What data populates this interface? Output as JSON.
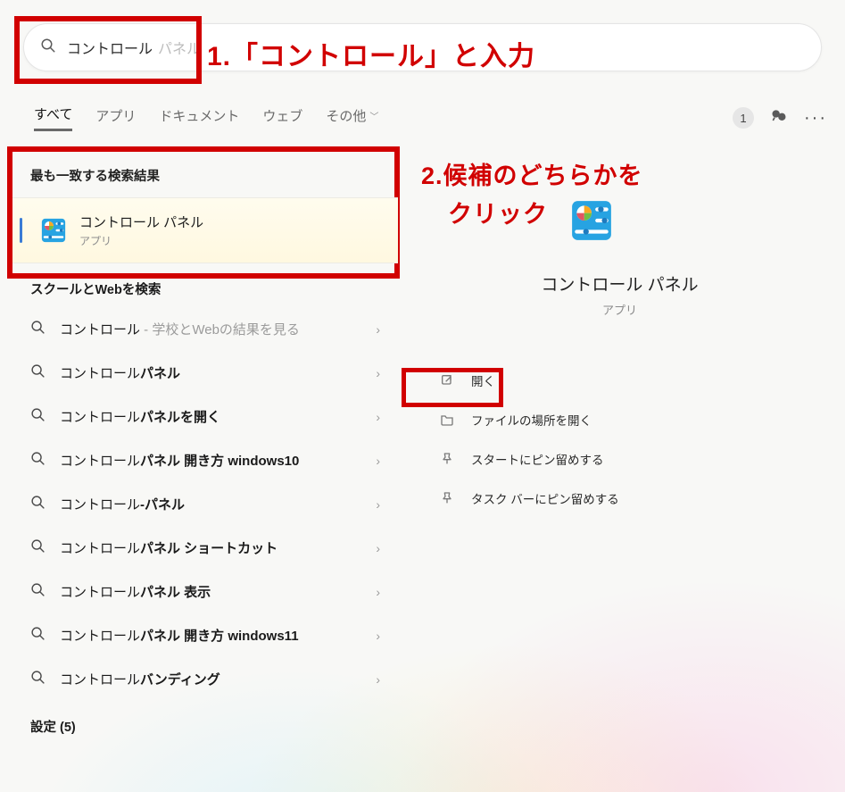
{
  "search": {
    "typed": "コントロール",
    "ghost_tail": "パネル"
  },
  "annotations": {
    "step1": "1.「コントロール」と入力",
    "step2_line1": "2.候補のどちらかを",
    "step2_line2": "クリック"
  },
  "tabs": {
    "all": "すべて",
    "apps": "アプリ",
    "documents": "ドキュメント",
    "web": "ウェブ",
    "more": "その他"
  },
  "badge_count": "1",
  "sections": {
    "best_match": "最も一致する検索結果",
    "school_web": "スクールとWebを検索",
    "settings_header": "設定 (5)"
  },
  "best_match_item": {
    "title_prefix": "コントロール",
    "title_suffix": " パネル",
    "subtitle": "アプリ"
  },
  "suggestions": [
    {
      "bold": "コントロール",
      "rest": "",
      "hint": " - 学校とWebの結果を見る"
    },
    {
      "bold": "コントロールパネル",
      "rest": "",
      "hint": ""
    },
    {
      "bold": "コントロールパネルを開く",
      "rest": "",
      "hint": ""
    },
    {
      "bold": "コントロールパネル 開き方 windows10",
      "rest": "",
      "hint": ""
    },
    {
      "bold": "コントロール-パネル",
      "rest": "",
      "hint": ""
    },
    {
      "bold": "コントロールパネル ショートカット",
      "rest": "",
      "hint": ""
    },
    {
      "bold": "コントロールパネル 表示",
      "rest": "",
      "hint": ""
    },
    {
      "bold": "コントロールパネル 開き方 windows11",
      "rest": "",
      "hint": ""
    },
    {
      "bold": "コントロールバンディング",
      "rest": "",
      "hint": ""
    }
  ],
  "detail": {
    "title": "コントロール パネル",
    "subtitle": "アプリ",
    "actions": {
      "open": "開く",
      "open_location": "ファイルの場所を開く",
      "pin_start": "スタートにピン留めする",
      "pin_taskbar": "タスク バーにピン留めする"
    }
  }
}
